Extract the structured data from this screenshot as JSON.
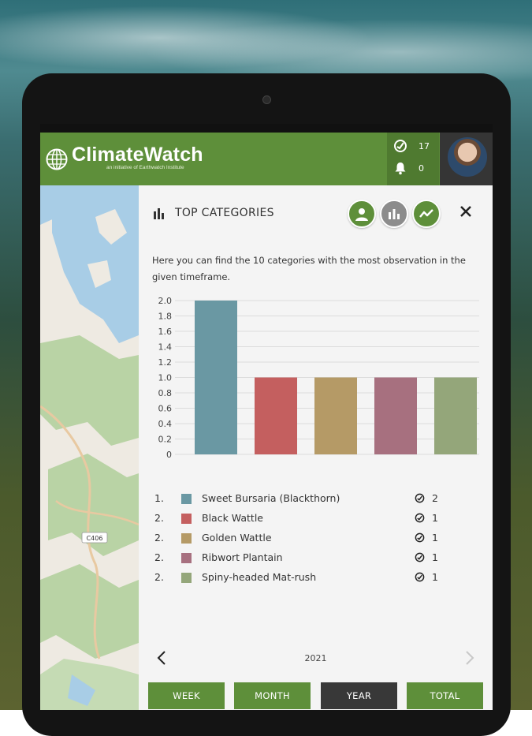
{
  "app": {
    "logo_text": "ClimateWatch",
    "logo_sub": "an initiative of Earthwatch Institute"
  },
  "header": {
    "observations_count": "17",
    "notifications_count": "0"
  },
  "map": {
    "road_label": "C406"
  },
  "panel": {
    "title": "TOP CATEGORIES",
    "description": "Here you can find the 10 categories with the most observation in the given timeframe."
  },
  "colors": {
    "brand_green": "#5e8f3a",
    "active_tab": "#383838"
  },
  "chart_data": {
    "type": "bar",
    "categories": [
      "Sweet Bursaria (Blackthorn)",
      "Black Wattle",
      "Golden Wattle",
      "Ribwort Plantain",
      "Spiny-headed Mat-rush"
    ],
    "values": [
      2,
      1,
      1,
      1,
      1
    ],
    "colors": [
      "#6a98a3",
      "#c45f5f",
      "#b59a66",
      "#a7707f",
      "#94a67a"
    ],
    "yticks": [
      "2.0",
      "1.8",
      "1.6",
      "1.4",
      "1.2",
      "1.0",
      "0.8",
      "0.6",
      "0.4",
      "0.2",
      "0"
    ],
    "ylim": [
      0,
      2
    ],
    "grid": true
  },
  "legend": [
    {
      "rank": "1.",
      "name": "Sweet Bursaria (Blackthorn)",
      "count": "2",
      "color": "#6a98a3"
    },
    {
      "rank": "2.",
      "name": "Black Wattle",
      "count": "1",
      "color": "#c45f5f"
    },
    {
      "rank": "2.",
      "name": "Golden Wattle",
      "count": "1",
      "color": "#b59a66"
    },
    {
      "rank": "2.",
      "name": "Ribwort Plantain",
      "count": "1",
      "color": "#a7707f"
    },
    {
      "rank": "2.",
      "name": "Spiny-headed Mat-rush",
      "count": "1",
      "color": "#94a67a"
    }
  ],
  "pager": {
    "year": "2021"
  },
  "tabs": [
    {
      "label": "WEEK",
      "active": false
    },
    {
      "label": "MONTH",
      "active": false
    },
    {
      "label": "YEAR",
      "active": true
    },
    {
      "label": "TOTAL",
      "active": false
    }
  ]
}
